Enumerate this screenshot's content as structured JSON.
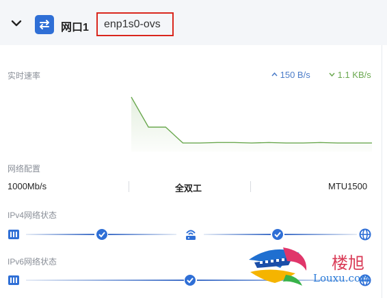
{
  "header": {
    "port_label": "网口1",
    "interface_name": "enp1s0-ovs"
  },
  "realtime": {
    "label": "实时速率",
    "upload": "150 B/s",
    "download": "1.1 KB/s",
    "upload_color": "#4a7bc8",
    "download_color": "#6aa84f"
  },
  "chart_data": {
    "type": "line",
    "series": [
      {
        "values": [
          100,
          45,
          45,
          16,
          16,
          17,
          17,
          16,
          17,
          16,
          16,
          17,
          16,
          16,
          16
        ]
      }
    ],
    "ylim": [
      0,
      100
    ]
  },
  "network_config": {
    "label": "网络配置",
    "speed": "1000Mb/s",
    "duplex": "全双工",
    "mtu": "MTU1500"
  },
  "ipv4": {
    "label": "IPv4网络状态",
    "icons": [
      "server-icon",
      "check-circle-icon",
      "router-icon",
      "check-circle-icon",
      "globe-icon"
    ]
  },
  "ipv6": {
    "label": "IPv6网络状态",
    "icons": [
      "server-icon",
      "check-circle-icon",
      "globe-icon"
    ]
  },
  "watermark": {
    "text": "楼旭",
    "url": "Louxu.com"
  }
}
